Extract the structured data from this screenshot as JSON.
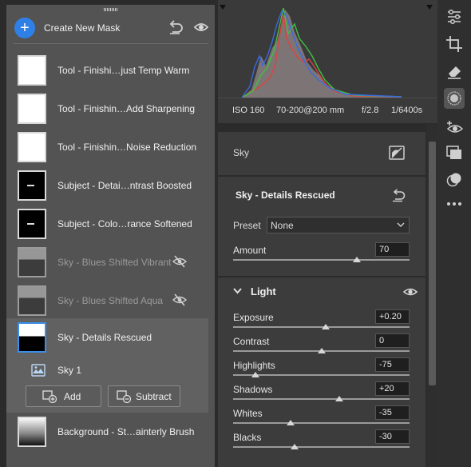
{
  "masks_panel": {
    "create_label": "Create New Mask",
    "masks": [
      {
        "name": "Tool - Finishi…just Temp Warm",
        "thumb": "white",
        "hidden": false
      },
      {
        "name": "Tool - Finishin…Add Sharpening",
        "thumb": "white",
        "hidden": false
      },
      {
        "name": "Tool - Finishin…Noise Reduction",
        "thumb": "white",
        "hidden": false
      },
      {
        "name": "Subject - Detai…ntrast Boosted",
        "thumb": "black",
        "hidden": false
      },
      {
        "name": "Subject - Colo…rance Softened",
        "thumb": "black",
        "hidden": false
      },
      {
        "name": "Sky - Blues Shifted Vibrant",
        "thumb": "sky",
        "hidden": true
      },
      {
        "name": "Sky - Blues Shifted Aqua",
        "thumb": "sky",
        "hidden": true
      },
      {
        "name": "Sky - Details Rescued",
        "thumb": "sky2",
        "hidden": false,
        "selected": true
      },
      {
        "name": "Background - St…ainterly Brush",
        "thumb": "grad",
        "hidden": false
      }
    ],
    "sub_component": "Sky 1",
    "add_label": "Add",
    "subtract_label": "Subtract"
  },
  "exif": {
    "iso": "ISO 160",
    "lens": "70-200@200 mm",
    "aperture": "f/2.8",
    "shutter": "1/6400s"
  },
  "mask_type": {
    "label": "Sky"
  },
  "mask_settings": {
    "title": "Sky - Details Rescued",
    "preset_label": "Preset",
    "preset_value": "None",
    "amount_label": "Amount",
    "amount_value": "70",
    "amount_level": 0.7
  },
  "light": {
    "title": "Light",
    "sliders": [
      {
        "label": "Exposure",
        "value": "+0.20",
        "level": 0.525
      },
      {
        "label": "Contrast",
        "value": "0",
        "level": 0.5
      },
      {
        "label": "Highlights",
        "value": "-75",
        "level": 0.125
      },
      {
        "label": "Shadows",
        "value": "+20",
        "level": 0.6
      },
      {
        "label": "Whites",
        "value": "-35",
        "level": 0.325
      },
      {
        "label": "Blacks",
        "value": "-30",
        "level": 0.35
      }
    ]
  },
  "colors": {
    "accent": "#2f80e6",
    "panel": "#535353",
    "selected": "#616161"
  }
}
